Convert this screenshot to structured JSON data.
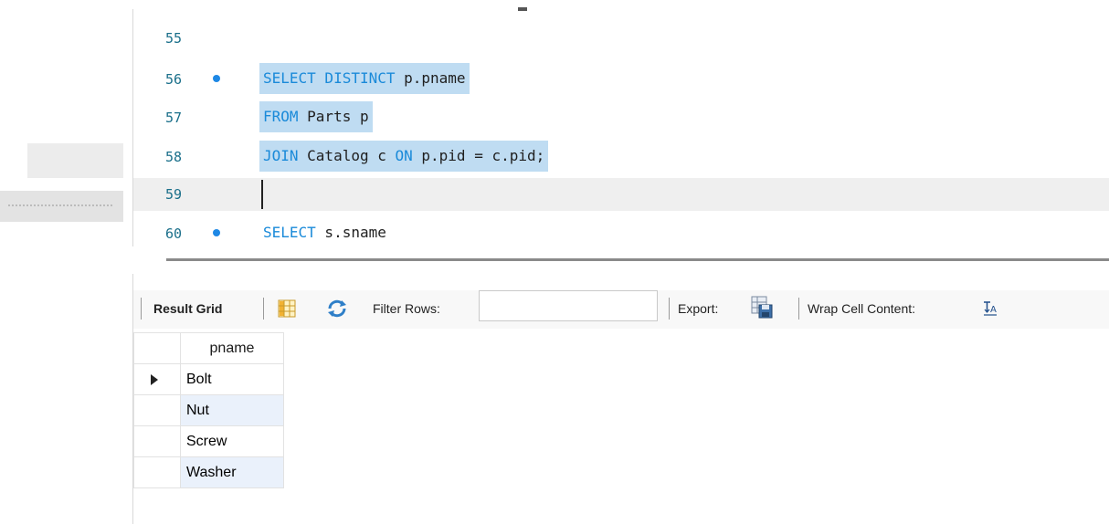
{
  "editor": {
    "lines": [
      {
        "number": "55",
        "dot": false,
        "tokens": []
      },
      {
        "number": "56",
        "dot": true,
        "selected": true,
        "tokens": [
          {
            "kw": true,
            "text": "SELECT DISTINCT"
          },
          {
            "kw": false,
            "text": " p.pname"
          }
        ]
      },
      {
        "number": "57",
        "dot": false,
        "selected": true,
        "tokens": [
          {
            "kw": true,
            "text": "FROM"
          },
          {
            "kw": false,
            "text": " Parts p"
          }
        ]
      },
      {
        "number": "58",
        "dot": false,
        "selected": true,
        "tokens": [
          {
            "kw": true,
            "text": "JOIN"
          },
          {
            "kw": false,
            "text": " Catalog c "
          },
          {
            "kw": true,
            "text": "ON"
          },
          {
            "kw": false,
            "text": " p.pid = c.pid;"
          }
        ]
      },
      {
        "number": "59",
        "dot": false,
        "current": true,
        "tokens": []
      },
      {
        "number": "60",
        "dot": true,
        "tokens": [
          {
            "kw": true,
            "text": "SELECT"
          },
          {
            "kw": false,
            "text": " s.sname"
          }
        ]
      }
    ]
  },
  "toolbar": {
    "result_grid_label": "Result Grid",
    "filter_rows_label": "Filter Rows:",
    "filter_rows_value": "",
    "export_label": "Export:",
    "wrap_label": "Wrap Cell Content:"
  },
  "result": {
    "column": "pname",
    "rows": [
      "Bolt",
      "Nut",
      "Screw",
      "Washer"
    ],
    "selected_row": 0
  },
  "colors": {
    "keyword": "#1a8ad9",
    "selection": "#bfdcf2",
    "line_number": "#1a6f8a",
    "breakpoint_dot": "#1e88e5"
  }
}
